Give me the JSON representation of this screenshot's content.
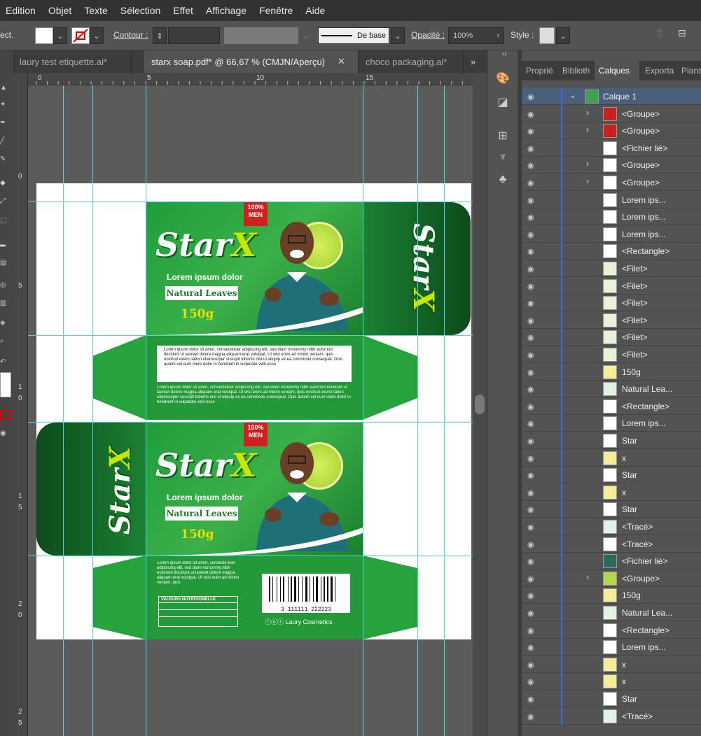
{
  "menu": [
    "Edition",
    "Objet",
    "Texte",
    "Sélection",
    "Effet",
    "Affichage",
    "Fenêtre",
    "Aide"
  ],
  "control": {
    "left_stub": "ect.",
    "contour_label": "Contour :",
    "stroke_profile": "De base",
    "opacity_label": "Opacité :",
    "opacity_value": "100%",
    "style_label": "Style :"
  },
  "tabs": [
    {
      "label": "laury test etiquette.ai*",
      "active": false
    },
    {
      "label": "starx soap.pdf* @ 66,67 % (CMJN/Aperçu)",
      "active": true
    },
    {
      "label": "choco packaging.ai*",
      "active": false
    }
  ],
  "tabs_overflow": "»",
  "ruler": {
    "h": [
      "0",
      "5",
      "10",
      "15"
    ],
    "v": [
      "0",
      "5",
      "1\n0",
      "1\n5",
      "2\n0",
      "2\n5"
    ]
  },
  "panel_tabs": [
    "Proprié",
    "Biblioth",
    "Calques",
    "Exporta",
    "Plans"
  ],
  "panel_collapse": "‹‹",
  "layers": [
    {
      "name": "Calque 1",
      "chev": "⌄",
      "thumb": "layer",
      "top": true
    },
    {
      "name": "<Groupe>",
      "chev": "›",
      "thumb": "red"
    },
    {
      "name": "<Groupe>",
      "chev": "›",
      "thumb": "red"
    },
    {
      "name": "<Fichier lié>",
      "chev": "",
      "thumb": "bw"
    },
    {
      "name": "<Groupe>",
      "chev": "›",
      "thumb": "white"
    },
    {
      "name": "<Groupe>",
      "chev": "›",
      "thumb": "white"
    },
    {
      "name": "Lorem ips...",
      "chev": "",
      "thumb": "white"
    },
    {
      "name": "Lorem ips...",
      "chev": "",
      "thumb": "white"
    },
    {
      "name": "Lorem ips...",
      "chev": "",
      "thumb": "white"
    },
    {
      "name": "<Rectangle>",
      "chev": "",
      "thumb": "white"
    },
    {
      "name": "<Filet>",
      "chev": "",
      "thumb": "leaf"
    },
    {
      "name": "<Filet>",
      "chev": "",
      "thumb": "leaf"
    },
    {
      "name": "<Filet>",
      "chev": "",
      "thumb": "leaf"
    },
    {
      "name": "<Filet>",
      "chev": "",
      "thumb": "leaf"
    },
    {
      "name": "<Filet>",
      "chev": "",
      "thumb": "leaf"
    },
    {
      "name": "<Filet>",
      "chev": "",
      "thumb": "leaf"
    },
    {
      "name": "150g",
      "chev": "",
      "thumb": "yellow"
    },
    {
      "name": "Natural Lea...",
      "chev": "",
      "thumb": "green"
    },
    {
      "name": "<Rectangle>",
      "chev": "",
      "thumb": "white"
    },
    {
      "name": "Lorem ips...",
      "chev": "",
      "thumb": "white"
    },
    {
      "name": "Star",
      "chev": "",
      "thumb": "white"
    },
    {
      "name": "x",
      "chev": "",
      "thumb": "yellow"
    },
    {
      "name": "Star",
      "chev": "",
      "thumb": "white"
    },
    {
      "name": "x",
      "chev": "",
      "thumb": "yellow"
    },
    {
      "name": "Star",
      "chev": "",
      "thumb": "white"
    },
    {
      "name": "<Tracé>",
      "chev": "",
      "thumb": "green"
    },
    {
      "name": "<Tracé>",
      "chev": "",
      "thumb": "white"
    },
    {
      "name": "<Fichier lié>",
      "chev": "",
      "thumb": "man"
    },
    {
      "name": "<Groupe>",
      "chev": "›",
      "thumb": "lime"
    },
    {
      "name": "150g",
      "chev": "",
      "thumb": "yellow"
    },
    {
      "name": "Natural Lea...",
      "chev": "",
      "thumb": "green"
    },
    {
      "name": "<Rectangle>",
      "chev": "",
      "thumb": "white"
    },
    {
      "name": "Lorem ips...",
      "chev": "",
      "thumb": "white"
    },
    {
      "name": "x",
      "chev": "",
      "thumb": "yellow"
    },
    {
      "name": "x",
      "chev": "",
      "thumb": "yellow"
    },
    {
      "name": "Star",
      "chev": "",
      "thumb": "white"
    },
    {
      "name": "<Tracé>",
      "chev": "",
      "thumb": "green"
    }
  ],
  "pack": {
    "brand": "Star",
    "brand_x": "X",
    "tagline": "Lorem ipsum dolor",
    "natural": "Natural Leaves",
    "weight": "150g",
    "badge": "100%\nMEN",
    "body_text": "Lorem ipsum dolor sit amet, consectetuer adipiscing elit, sed diam nonummy nibh euismod tincidunt ut laoreet dolore magna aliquam erat volutpat. Ut wisi enim ad minim veniam, quis nostrud exerci tation ullamcorper suscipit lobortis nisl ut aliquip ex ea commodo consequat. Duis autem vel eum iriure dolor in hendrerit in vulputate velit esse",
    "body_text2": "Lorem ipsum dolor sit amet, consectetuer adipiscing elit, sed diam nonummy nibh euismod tincidunt ut laoreet dolore magna aliquam erat volutpat. Ut wisi enim ad minim veniam, quis nostrud exerci tation ullamcorper suscipit lobortis nisl ut aliquip ex ea commodo consequat. Duis autem vel eum iriure dolor in hendrerit in vulputate velit esse",
    "back_text": "Lorem ipsum dolor sit amet, consecte-tuer adipiscing elit, sed diam nonummy nibh euismod tincidunt ut laoreet dolore magna aliquam erat volutpat. Ut wisi enim ad minim veniam, quis",
    "nutrition_title": "VALEURS NUTRITIONELLE",
    "barcode_number": "3 111111 222223",
    "company": "Laury Cosmetics"
  },
  "colors": {
    "guide": "#4fd5e0",
    "pack_green": "#1f9d3a",
    "accent_yellow": "#c8e600",
    "badge_red": "#d0201f",
    "layer_selected": "#4a5f7c"
  }
}
